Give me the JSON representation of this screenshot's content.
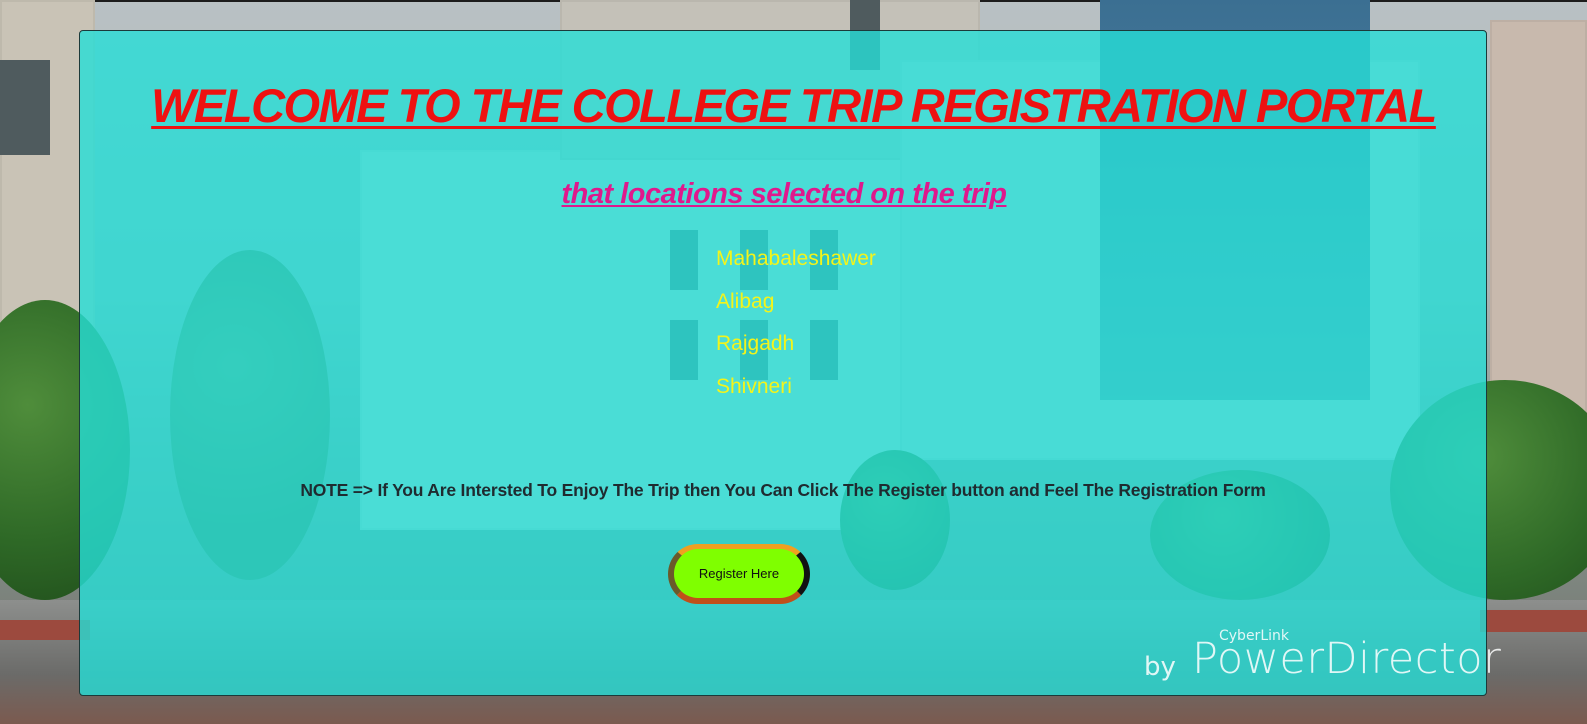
{
  "page": {
    "title": "WELCOME TO THE COLLEGE TRIP REGISTRATION PORTAL",
    "subtitle": "that locations selected on the trip",
    "locations": [
      "Mahabaleshawer",
      "Alibag",
      "Rajgadh",
      "Shivneri"
    ],
    "note": "NOTE => If You Are Intersted To Enjoy The Trip then You Can Click The Register button and Feel The Registration Form",
    "register_label": "Register Here"
  },
  "watermark": {
    "small": "CyberLink",
    "by": "by",
    "big": "PowerDirector"
  },
  "colors": {
    "panel_overlay": "#26ded7",
    "title": "#ee1111",
    "subtitle": "#e0188c",
    "locations": "#f4f41a",
    "note": "#1f2b30",
    "button_bg": "#7fff00"
  }
}
